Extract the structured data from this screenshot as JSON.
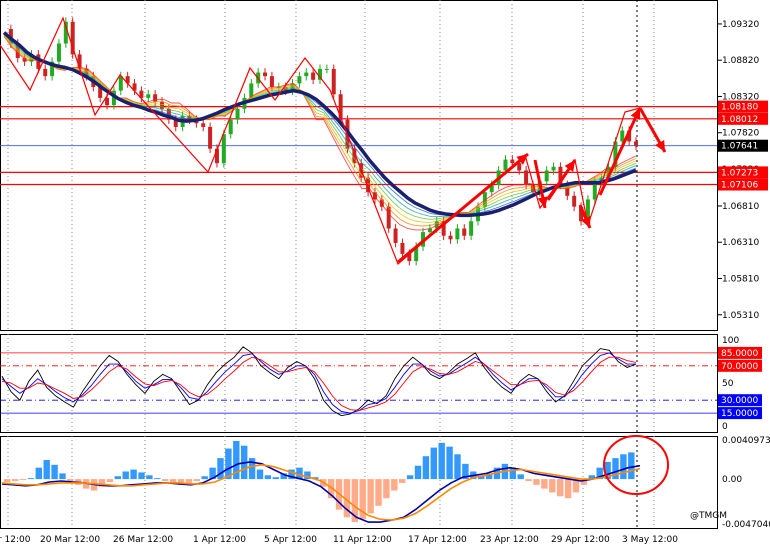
{
  "chart_data": [
    {
      "type": "candlestick",
      "panel": "price",
      "y_ticks": [
        "1.09320",
        "1.08820",
        "1.08320",
        "1.07820",
        "1.07320",
        "1.06810",
        "1.06310",
        "1.05810",
        "1.05310"
      ],
      "ylim": [
        1.051,
        1.0965
      ],
      "current_price": "1.07641",
      "levels": [
        {
          "label": "1.08180",
          "value": 1.0818,
          "color": "#ff0000"
        },
        {
          "label": "1.08012",
          "value": 1.08012,
          "color": "#ff0000"
        },
        {
          "label": "1.07273",
          "value": 1.07273,
          "color": "#ff0000"
        },
        {
          "label": "1.07106",
          "value": 1.07106,
          "color": "#ff0000"
        }
      ],
      "close_series": [
        1.0925,
        1.0905,
        1.0885,
        1.088,
        1.089,
        1.087,
        1.086,
        1.088,
        1.0905,
        1.0935,
        1.089,
        1.087,
        1.086,
        1.0845,
        1.083,
        1.082,
        1.084,
        1.086,
        1.085,
        1.084,
        1.083,
        1.0835,
        1.0825,
        1.0815,
        1.08,
        1.079,
        1.0805,
        1.08,
        1.0795,
        1.079,
        1.076,
        1.074,
        1.078,
        1.08,
        1.0815,
        1.083,
        1.085,
        1.0865,
        1.086,
        1.0845,
        1.0845,
        1.084,
        1.085,
        1.086,
        1.0865,
        1.0855,
        1.087,
        1.087,
        1.0835,
        1.08,
        1.076,
        1.074,
        1.072,
        1.07,
        1.069,
        1.068,
        1.065,
        1.063,
        1.0615,
        1.0605,
        1.0625,
        1.0645,
        1.065,
        1.066,
        1.064,
        1.0635,
        1.065,
        1.064,
        1.066,
        1.068,
        1.07,
        1.071,
        1.073,
        1.0745,
        1.074,
        1.073,
        1.071,
        1.07,
        1.0715,
        1.073,
        1.0735,
        1.071,
        1.0695,
        1.068,
        1.066,
        1.069,
        1.0715,
        1.072,
        1.0735,
        1.077,
        1.0785,
        1.077,
        1.0764
      ],
      "ma_series": [
        {
          "name": "",
          "color": "#1a1f6e",
          "values": [
            1.092,
            1.0911,
            1.0903,
            1.0893,
            1.0886,
            1.0881,
            1.0877,
            1.0874,
            1.0872,
            1.0869,
            1.0864,
            1.0858,
            1.0851,
            1.0843,
            1.0836,
            1.0829,
            1.0824,
            1.082,
            1.0817,
            1.0813,
            1.081,
            1.0806,
            1.0803,
            1.0799,
            1.0798,
            1.0799,
            1.0801,
            1.0805,
            1.0809,
            1.0814,
            1.0818,
            1.0822,
            1.0825,
            1.0828,
            1.0831,
            1.0834,
            1.0836,
            1.0838,
            1.084,
            1.0838,
            1.0834,
            1.0828,
            1.0819,
            1.0809,
            1.0798,
            1.0785,
            1.0771,
            1.0758,
            1.0744,
            1.0732,
            1.072,
            1.071,
            1.0701,
            1.0692,
            1.0685,
            1.068,
            1.0675,
            1.0672,
            1.067,
            1.0669,
            1.0668,
            1.0668,
            1.0669,
            1.067,
            1.0672,
            1.0675,
            1.0679,
            1.0683,
            1.0688,
            1.0693,
            1.0698,
            1.0702,
            1.0706,
            1.0709,
            1.0711,
            1.0713,
            1.0713,
            1.0713,
            1.0713,
            1.0715,
            1.0718,
            1.0722,
            1.0726,
            1.073
          ]
        },
        {
          "name": "",
          "color": "#f08030",
          "values": [
            1.0915,
            1.09,
            1.089,
            1.0882,
            1.088,
            1.0876,
            1.087,
            1.0868,
            1.0872,
            1.087,
            1.086,
            1.085,
            1.084,
            1.083,
            1.0825,
            1.0822,
            1.0825,
            1.0828,
            1.0828,
            1.0823,
            1.0815,
            1.0805,
            1.08,
            1.08,
            1.0805,
            1.0812,
            1.082,
            1.0828,
            1.0835,
            1.084,
            1.0845,
            1.0848,
            1.085,
            1.084,
            1.0822,
            1.08,
            1.078,
            1.076,
            1.074,
            1.0722,
            1.0705,
            1.069,
            1.0678,
            1.0665,
            1.0655,
            1.065,
            1.0648,
            1.065,
            1.0655,
            1.066,
            1.0665,
            1.0672,
            1.068,
            1.0688,
            1.0695,
            1.0702,
            1.0707,
            1.071,
            1.0712,
            1.071,
            1.0707,
            1.0705,
            1.0705,
            1.0708,
            1.0712,
            1.0718,
            1.0724,
            1.0732,
            1.074,
            1.0745,
            1.075
          ]
        }
      ]
    },
    {
      "type": "line",
      "panel": "stochastic",
      "y_ticks": [
        "100",
        "50",
        "0"
      ],
      "levels": [
        {
          "label": "85.0000",
          "value": 85,
          "color": "#ff0000"
        },
        {
          "label": "70.0000",
          "value": 70,
          "color": "#ff0000"
        },
        {
          "label": "30.0000",
          "value": 30,
          "color": "#0000ff"
        },
        {
          "label": "15.0000",
          "value": 15,
          "color": "#0000ff"
        }
      ],
      "series": [
        {
          "name": "",
          "color": "#000000",
          "values": [
            58,
            40,
            30,
            52,
            65,
            45,
            35,
            28,
            22,
            40,
            55,
            70,
            82,
            75,
            60,
            48,
            38,
            52,
            60,
            55,
            40,
            25,
            30,
            48,
            62,
            72,
            80,
            92,
            85,
            70,
            62,
            55,
            68,
            75,
            70,
            55,
            30,
            18,
            12,
            14,
            20,
            30,
            26,
            35,
            55,
            70,
            80,
            72,
            60,
            55,
            62,
            72,
            78,
            85,
            68,
            55,
            45,
            38,
            52,
            60,
            55,
            40,
            28,
            35,
            52,
            70,
            80,
            90,
            88,
            75,
            68,
            72
          ]
        },
        {
          "name": "",
          "color": "#0000ff",
          "values": [
            55,
            46,
            38,
            45,
            55,
            48,
            40,
            33,
            28,
            36,
            47,
            60,
            72,
            72,
            63,
            52,
            44,
            48,
            54,
            54,
            45,
            33,
            31,
            40,
            52,
            63,
            72,
            82,
            84,
            75,
            66,
            60,
            64,
            70,
            70,
            60,
            40,
            25,
            17,
            15,
            18,
            25,
            27,
            32,
            45,
            60,
            72,
            72,
            64,
            58,
            60,
            67,
            73,
            80,
            72,
            60,
            50,
            42,
            48,
            55,
            55,
            45,
            34,
            34,
            45,
            60,
            72,
            82,
            85,
            78,
            72,
            72
          ]
        },
        {
          "name": "",
          "color": "#ff0000",
          "values": [
            52,
            50,
            44,
            44,
            50,
            48,
            43,
            38,
            32,
            34,
            42,
            52,
            63,
            70,
            66,
            57,
            49,
            47,
            51,
            53,
            48,
            39,
            34,
            37,
            45,
            55,
            64,
            74,
            80,
            77,
            70,
            63,
            63,
            66,
            68,
            63,
            50,
            35,
            24,
            19,
            18,
            21,
            24,
            28,
            37,
            50,
            63,
            69,
            66,
            61,
            60,
            63,
            69,
            75,
            72,
            64,
            56,
            48,
            48,
            52,
            53,
            48,
            39,
            36,
            41,
            51,
            63,
            74,
            80,
            80,
            76,
            74
          ]
        }
      ]
    },
    {
      "type": "bar",
      "panel": "macd",
      "y_ticks": [
        "0.0040973",
        "0.00",
        "-0.0047040"
      ],
      "ylim": [
        -0.004704,
        0.0040973
      ],
      "histogram": [
        -0.0003,
        -0.0002,
        -0.0001,
        0.0001,
        0.0012,
        0.002,
        0.0015,
        0.0006,
        -0.0002,
        -0.0006,
        -0.001,
        -0.0012,
        -0.0008,
        -0.0003,
        0.0003,
        0.0008,
        0.001,
        0.0007,
        0.0004,
        0.0001,
        -0.0002,
        -0.0005,
        -0.0006,
        -0.0004,
        -0.0002,
        0.0003,
        0.0012,
        0.0022,
        0.0032,
        0.004,
        0.0035,
        0.0022,
        0.001,
        0.0004,
        0.0002,
        0.0006,
        0.001,
        0.0012,
        0.0008,
        0.0002,
        -0.0008,
        -0.002,
        -0.0032,
        -0.004,
        -0.0045,
        -0.0042,
        -0.0036,
        -0.0028,
        -0.002,
        -0.0012,
        -0.0004,
        0.0004,
        0.0014,
        0.0024,
        0.0033,
        0.0038,
        0.0034,
        0.0026,
        0.0016,
        0.0008,
        0.0003,
        0.0006,
        0.0012,
        0.0016,
        0.0012,
        0.0005,
        -0.0002,
        -0.0006,
        -0.001,
        -0.0014,
        -0.0018,
        -0.002,
        -0.0014,
        -0.0006,
        0.0004,
        0.0012,
        0.0018,
        0.0022,
        0.0026,
        0.0028
      ],
      "series": [
        {
          "name": "",
          "color": "#0000aa",
          "values": [
            -0.0005,
            -0.0006,
            -0.0007,
            -0.0006,
            -0.0003,
            -0.0002,
            -0.0003,
            -0.0004,
            -0.0006,
            -0.0007,
            -0.0007,
            -0.0006,
            -0.0005,
            -0.0004,
            -0.0004,
            -0.0005,
            -0.0006,
            -0.0004,
            0.0002,
            0.001,
            0.0016,
            0.0018,
            0.0016,
            0.001,
            0.0004,
            0.0001,
            -0.0002,
            -0.0008,
            -0.0018,
            -0.003,
            -0.004,
            -0.0045,
            -0.0045,
            -0.0043,
            -0.004,
            -0.0032,
            -0.0022,
            -0.0012,
            -0.0004,
            0.0002,
            0.0004,
            0.0006,
            0.001,
            0.0012,
            0.001,
            0.0006,
            0.0004,
            0.0002,
            0.0,
            -0.0002,
            0.0,
            0.0004,
            0.0008,
            0.0012,
            0.0014
          ]
        },
        {
          "name": "",
          "color": "#ff8800",
          "values": [
            -0.0004,
            -0.0005,
            -0.0006,
            -0.0006,
            -0.0005,
            -0.0004,
            -0.0004,
            -0.0004,
            -0.0005,
            -0.0006,
            -0.0007,
            -0.0007,
            -0.0006,
            -0.0005,
            -0.0004,
            -0.0004,
            -0.0005,
            -0.0005,
            -0.0003,
            0.0002,
            0.0008,
            0.0013,
            0.0015,
            0.0013,
            0.0009,
            0.0005,
            0.0002,
            -0.0002,
            -0.001,
            -0.002,
            -0.003,
            -0.0038,
            -0.0042,
            -0.0043,
            -0.0041,
            -0.0036,
            -0.0028,
            -0.0019,
            -0.001,
            -0.0003,
            0.0002,
            0.0004,
            0.0007,
            0.0009,
            0.001,
            0.0008,
            0.0006,
            0.0004,
            0.0002,
            0.0,
            0.0,
            0.0002,
            0.0005,
            0.0008,
            0.0011
          ]
        }
      ]
    }
  ],
  "x_tick_labels": [
    "r 12:00",
    "20 Mar 12:00",
    "26 Mar 12:00",
    "1 Apr 12:00",
    "5 Apr 12:00",
    "11 Apr 12:00",
    "17 Apr 12:00",
    "23 Apr 12:00",
    "29 Apr 12:00",
    "3 May 12:00"
  ],
  "watermark": "@TMGM",
  "colors": {
    "level_line": "#ff0000",
    "price_line": "#3a5bd9",
    "arrow": "#ff0000",
    "circle": "#ff0000",
    "hist_pos": "#3399ff",
    "hist_neg": "#ffaa88"
  }
}
